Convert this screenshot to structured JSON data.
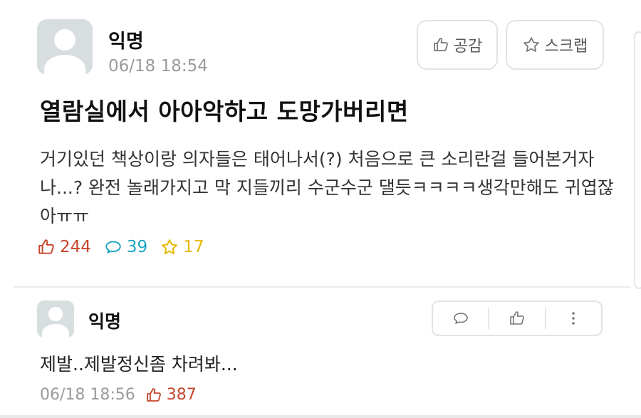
{
  "post": {
    "author": "익명",
    "time": "06/18 18:54",
    "title": "열람실에서 아아악하고 도망가버리면",
    "content": "거기있던 책상이랑 의자들은 태어나서(?) 처음으로 큰 소리란걸 들어본거자나...? 완전 놀래가지고 막 지들끼리 수군수군 댈듯ㅋㅋㅋㅋ생각만해도 귀엽잖아ㅠㅠ",
    "buttons": {
      "like": "공감",
      "scrap": "스크랩"
    },
    "stats": {
      "likes": "244",
      "comments": "39",
      "scraps": "17"
    }
  },
  "comment": {
    "author": "익명",
    "content": "제발..제발정신좀 차려봐...",
    "time": "06/18 18:56",
    "likes": "387"
  },
  "colors": {
    "like": "#c6452c",
    "comment": "#1da5c3",
    "scrap": "#e5b800",
    "muted": "#9a9a9a"
  },
  "icons": [
    "thumbs-up-icon",
    "star-icon",
    "speech-bubble-icon",
    "more-vertical-icon",
    "anonymous-avatar"
  ]
}
